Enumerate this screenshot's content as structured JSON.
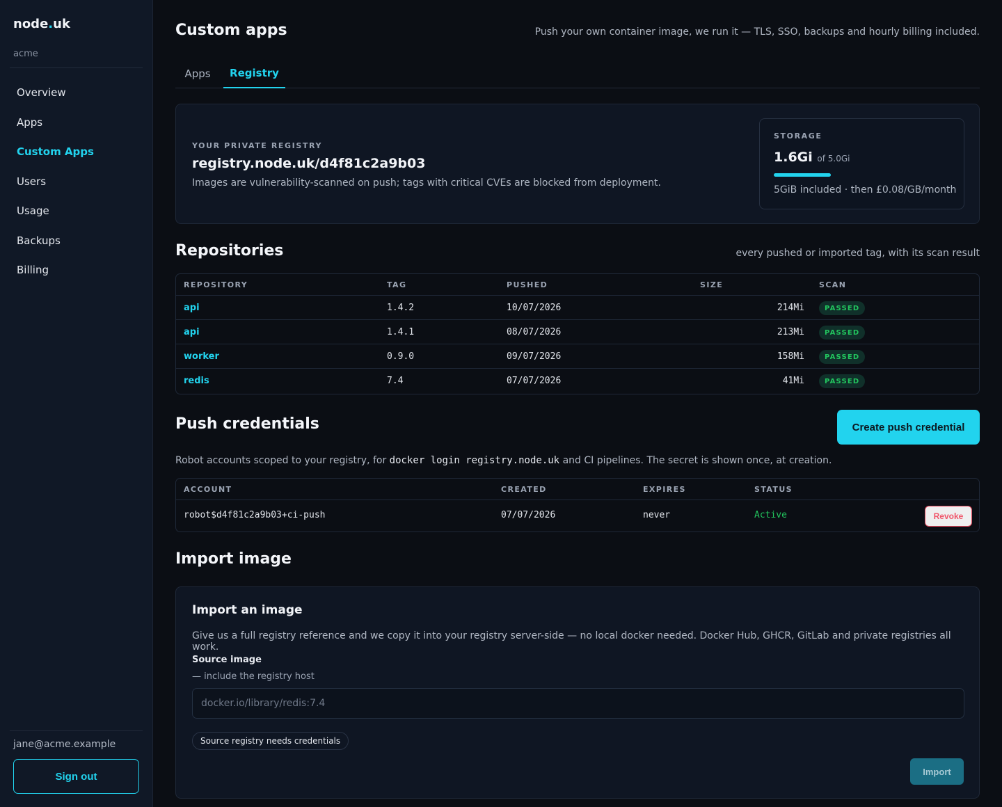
{
  "brand": {
    "name": "node",
    "dot": ".",
    "tld": "uk",
    "org": "acme"
  },
  "nav": {
    "items": [
      "Overview",
      "Apps",
      "Custom Apps",
      "Users",
      "Usage",
      "Backups",
      "Billing"
    ],
    "active": "Custom Apps"
  },
  "user": {
    "email": "jane@acme.example",
    "signout_label": "Sign out"
  },
  "header": {
    "title": "Custom apps",
    "subtitle": "Push your own container image, we run it — TLS, SSO, backups and hourly billing included."
  },
  "tabs": [
    {
      "label": "Apps"
    },
    {
      "label": "Registry"
    }
  ],
  "active_tab": "Registry",
  "registry": {
    "eyebrow": "YOUR PRIVATE REGISTRY",
    "host": "registry.node.uk/d4f81c2a9b03",
    "note": "Images are vulnerability-scanned on push; tags with critical CVEs are blocked from deployment.",
    "storage": {
      "eyebrow": "STORAGE",
      "used": "1.6Gi",
      "of": "of 5.0Gi",
      "fraction": 0.32,
      "note": "5GiB included · then £0.08/GB/month"
    }
  },
  "repositories": {
    "title": "Repositories",
    "subtitle": "every pushed or imported tag, with its scan result",
    "columns": [
      "REPOSITORY",
      "TAG",
      "PUSHED",
      "SIZE",
      "SCAN"
    ],
    "rows": [
      {
        "repo": "api",
        "tag": "1.4.2",
        "pushed": "10/07/2026",
        "size": "214Mi",
        "scan": "PASSED"
      },
      {
        "repo": "api",
        "tag": "1.4.1",
        "pushed": "08/07/2026",
        "size": "213Mi",
        "scan": "PASSED"
      },
      {
        "repo": "worker",
        "tag": "0.9.0",
        "pushed": "09/07/2026",
        "size": "158Mi",
        "scan": "PASSED"
      },
      {
        "repo": "redis",
        "tag": "7.4",
        "pushed": "07/07/2026",
        "size": "41Mi",
        "scan": "PASSED"
      }
    ]
  },
  "credentials": {
    "title": "Push credentials",
    "create_label": "Create push credential",
    "desc_before": "Robot accounts scoped to your registry, for",
    "desc_code": "docker login registry.node.uk",
    "desc_after": "and CI pipelines. The secret is shown once, at creation.",
    "columns": [
      "ACCOUNT",
      "CREATED",
      "EXPIRES",
      "STATUS"
    ],
    "rows": [
      {
        "account": "robot$d4f81c2a9b03+ci-push",
        "created": "07/07/2026",
        "expires": "never",
        "status": "Active",
        "action": "Revoke"
      }
    ]
  },
  "import": {
    "section_title": "Import image",
    "card_title": "Import an image",
    "desc": "Give us a full registry reference and we copy it into your registry server-side — no local docker needed. Docker Hub, GHCR, GitLab and private registries all work.",
    "field_label": "Source image",
    "field_hint": "— include the registry host",
    "placeholder": "docker.io/library/redis:7.4",
    "value": "",
    "creds_toggle": "Source registry needs credentials",
    "submit_label": "Import"
  },
  "colors": {
    "accent": "#22d3ee",
    "success": "#22c55e",
    "danger": "#e2465a",
    "bg": "#0b0e14",
    "sidebar": "#101826"
  }
}
